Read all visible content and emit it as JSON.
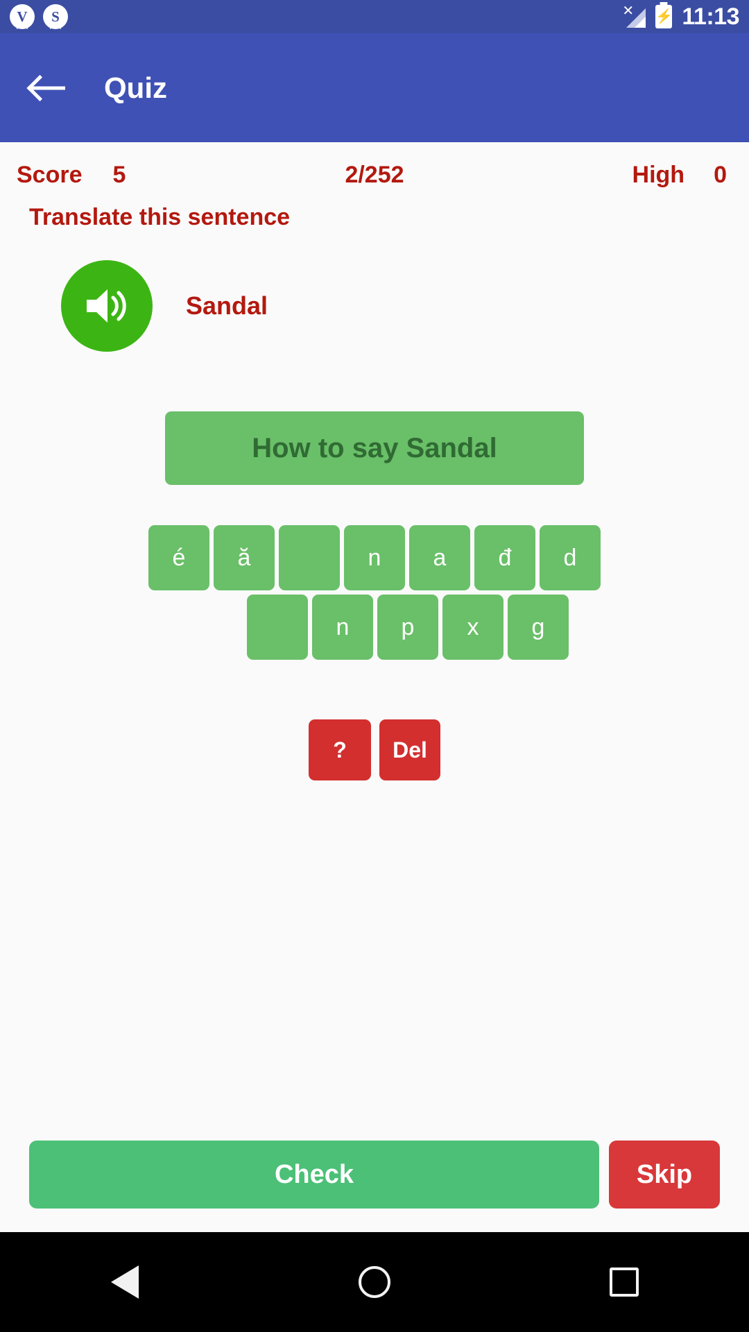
{
  "statusbar": {
    "notifications": [
      {
        "label": "V",
        "name": "notification-badge-v"
      },
      {
        "label": "S",
        "name": "notification-badge-s"
      }
    ],
    "signal_icon": "signal-no-service-icon",
    "battery_icon": "battery-charging-icon",
    "time": "11:13"
  },
  "appbar": {
    "back_icon": "back-arrow-icon",
    "title": "Quiz"
  },
  "scorebar": {
    "score_label": "Score",
    "score_value": "5",
    "progress": "2/252",
    "high_label": "High",
    "high_value": "0"
  },
  "question": {
    "instruction": "Translate this sentence",
    "speaker_icon": "speaker-volume-icon",
    "word": "Sandal",
    "answer_placeholder": "How to say Sandal"
  },
  "keyboard": {
    "row1": [
      "é",
      "ă",
      "",
      "n",
      "a",
      "đ",
      "d"
    ],
    "row2": [
      "",
      "n",
      "p",
      "x",
      "g"
    ],
    "help_label": "?",
    "delete_label": "Del"
  },
  "actions": {
    "check_label": "Check",
    "skip_label": "Skip"
  },
  "navbar": {
    "back": "nav-back-triangle-icon",
    "home": "nav-home-circle-icon",
    "recents": "nav-recents-square-icon"
  },
  "colors": {
    "appbar": "#3f51b5",
    "statusbar": "#3b4da3",
    "accent_red": "#b3190f",
    "tile_green": "#6abf69",
    "speaker_green": "#3cb514",
    "check_green": "#4cc077",
    "skip_red": "#d8383a",
    "control_red": "#d32f2f"
  }
}
